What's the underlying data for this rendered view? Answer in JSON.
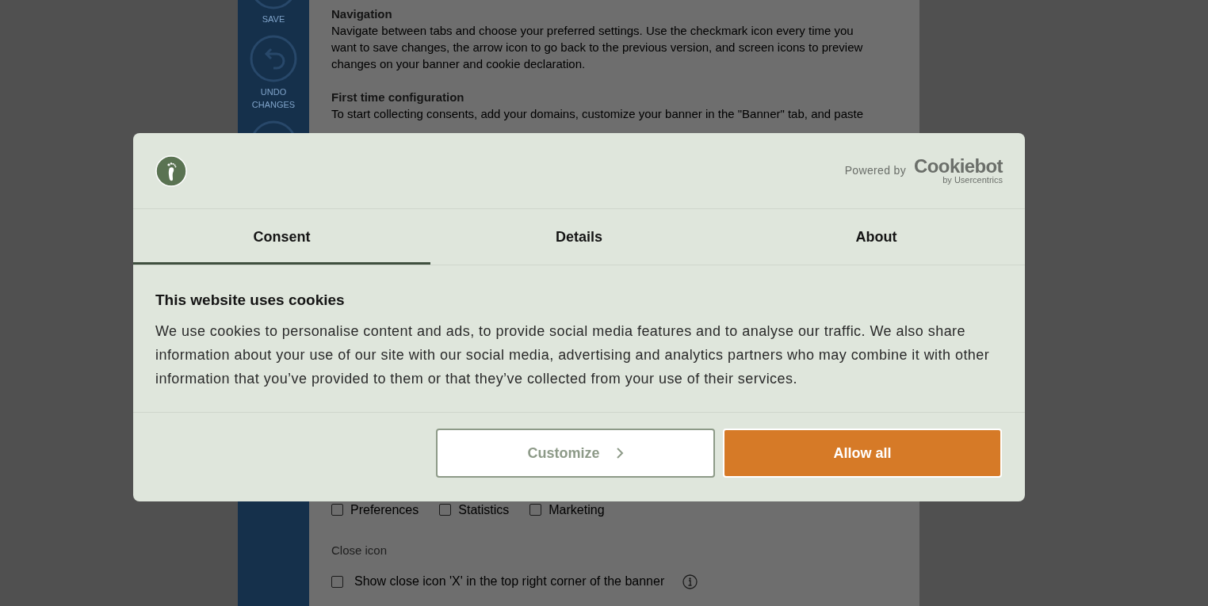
{
  "sidebar": {
    "items": [
      {
        "kind": "save",
        "label": "SAVE"
      },
      {
        "kind": "undo",
        "label": "UNDO CHANGES"
      },
      {
        "kind": "preview"
      }
    ]
  },
  "sections": [
    {
      "heading": "Navigation",
      "text": "Navigate between tabs and choose your preferred settings. Use the checkmark icon every time you\nwant to save changes, the arrow icon to go back to the previous version, and screen icons to preview\nchanges on your banner and cookie declaration."
    },
    {
      "heading": "First time configuration",
      "text": "To start collecting consents, add your domains, customize your banner in the \"Banner\" tab, and paste"
    }
  ],
  "categories": [
    {
      "label": "Preferences",
      "checked": false
    },
    {
      "label": "Statistics",
      "checked": false
    },
    {
      "label": "Marketing",
      "checked": false
    }
  ],
  "close_icon": {
    "label": "Close icon",
    "option": {
      "label": "Show close icon 'X' in the top right corner of the banner",
      "checked": false
    }
  },
  "dialog": {
    "powered_by": "Powered by",
    "brand": "Cookiebot",
    "brand_sub": "by Usercentrics",
    "tabs": [
      {
        "label": "Consent",
        "selected": true
      },
      {
        "label": "Details",
        "selected": false
      },
      {
        "label": "About",
        "selected": false
      }
    ],
    "title": "This website uses cookies",
    "body": "We use cookies to personalise content and ads, to provide social media features and to analyse our traffic. We also share information about your use of our site with our social media, advertising and analytics partners who may combine it with other information that you’ve provided to them or that they’ve collected from your use of their services.",
    "buttons": [
      {
        "kind": "secondary",
        "label": "Customize"
      },
      {
        "kind": "primary",
        "label": "Allow all"
      }
    ]
  }
}
